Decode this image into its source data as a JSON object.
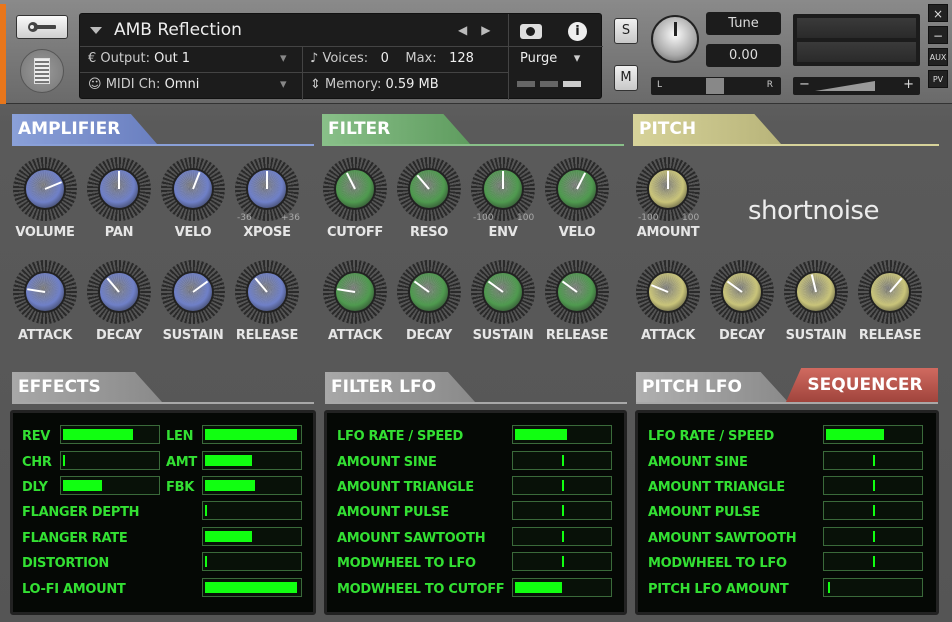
{
  "instrument": {
    "name": "AMB Reflection",
    "output_label": "Output:",
    "output_value": "Out 1",
    "voices_label": "Voices:",
    "voices_value": "0",
    "max_label": "Max:",
    "max_value": "128",
    "purge_label": "Purge",
    "midi_label": "MIDI Ch:",
    "midi_value": "Omni",
    "memory_label": "Memory:",
    "memory_value": "0.59 MB",
    "solo_label": "S",
    "mute_label": "M",
    "tune_label": "Tune",
    "tune_value": "0.00",
    "pan_left": "L",
    "pan_right": "R",
    "vol_minus": "−",
    "vol_plus": "+",
    "side_buttons": [
      "×",
      "−",
      "AUX",
      "PV"
    ]
  },
  "colors": {
    "amplifier": "#6f80c8",
    "filter": "#4f9a4f",
    "pitch": "#c9c47a",
    "accent": "#e8761b",
    "lfo_green": "#11ff11"
  },
  "sections": {
    "amplifier": "AMPLIFIER",
    "filter": "FILTER",
    "pitch": "PITCH",
    "effects": "EFFECTS",
    "filter_lfo": "FILTER LFO",
    "pitch_lfo": "PITCH LFO",
    "sequencer": "SEQUENCER"
  },
  "brand": "shortnoise",
  "amp_knobs": [
    {
      "label": "VOLUME",
      "value": 0.75
    },
    {
      "label": "PAN",
      "value": 0.5
    },
    {
      "label": "VELO",
      "value": 0.58
    },
    {
      "label": "XPOSE",
      "value": 0.5,
      "range_min": "-36",
      "range_max": "+36"
    },
    {
      "label": "ATTACK",
      "value": 0.2
    },
    {
      "label": "DECAY",
      "value": 0.35
    },
    {
      "label": "SUSTAIN",
      "value": 0.7
    },
    {
      "label": "RELEASE",
      "value": 0.35
    }
  ],
  "filter_knobs": [
    {
      "label": "CUTOFF",
      "value": 0.4
    },
    {
      "label": "RESO",
      "value": 0.35
    },
    {
      "label": "ENV",
      "value": 0.5,
      "range_min": "-100",
      "range_max": "100"
    },
    {
      "label": "VELO",
      "value": 0.6
    },
    {
      "label": "ATTACK",
      "value": 0.2
    },
    {
      "label": "DECAY",
      "value": 0.3
    },
    {
      "label": "SUSTAIN",
      "value": 0.3
    },
    {
      "label": "RELEASE",
      "value": 0.3
    }
  ],
  "pitch_knobs": [
    {
      "label": "AMOUNT",
      "value": 0.5,
      "range_min": "-100",
      "range_max": "100"
    },
    {
      "label": "ATTACK",
      "value": 0.25
    },
    {
      "label": "DECAY",
      "value": 0.3
    },
    {
      "label": "SUSTAIN",
      "value": 0.45
    },
    {
      "label": "RELEASE",
      "value": 0.65
    }
  ],
  "effects": {
    "short": [
      {
        "label": "REV",
        "value": 0.74
      },
      {
        "label": "CHR",
        "value": 0.02
      },
      {
        "label": "DLY",
        "value": 0.41
      }
    ],
    "short2": [
      {
        "label": "LEN",
        "value": 0.98
      },
      {
        "label": "AMT",
        "value": 0.5
      },
      {
        "label": "FBK",
        "value": 0.53
      }
    ],
    "long": [
      {
        "label": "FLANGER DEPTH",
        "value": 0.02
      },
      {
        "label": "FLANGER RATE",
        "value": 0.5
      },
      {
        "label": "DISTORTION",
        "value": 0.02
      },
      {
        "label": "LO-FI AMOUNT",
        "value": 0.98
      }
    ]
  },
  "filter_lfo": [
    {
      "label": "LFO RATE / SPEED",
      "value": 0.55,
      "mode": "fill"
    },
    {
      "label": "AMOUNT SINE",
      "value": 0.5,
      "mode": "tick"
    },
    {
      "label": "AMOUNT TRIANGLE",
      "value": 0.5,
      "mode": "tick"
    },
    {
      "label": "AMOUNT PULSE",
      "value": 0.5,
      "mode": "tick"
    },
    {
      "label": "AMOUNT SAWTOOTH",
      "value": 0.5,
      "mode": "tick"
    },
    {
      "label": "MODWHEEL TO LFO",
      "value": 0.5,
      "mode": "tick"
    },
    {
      "label": "MODWHEEL TO CUTOFF",
      "value": 0.5,
      "mode": "fill"
    }
  ],
  "pitch_lfo": [
    {
      "label": "LFO RATE / SPEED",
      "value": 0.62,
      "mode": "fill"
    },
    {
      "label": "AMOUNT SINE",
      "value": 0.5,
      "mode": "tick"
    },
    {
      "label": "AMOUNT TRIANGLE",
      "value": 0.5,
      "mode": "tick"
    },
    {
      "label": "AMOUNT PULSE",
      "value": 0.5,
      "mode": "tick"
    },
    {
      "label": "AMOUNT SAWTOOTH",
      "value": 0.5,
      "mode": "tick"
    },
    {
      "label": "MODWHEEL TO LFO",
      "value": 0.5,
      "mode": "tick"
    },
    {
      "label": "PITCH LFO AMOUNT",
      "value": 0.02,
      "mode": "tick"
    }
  ]
}
